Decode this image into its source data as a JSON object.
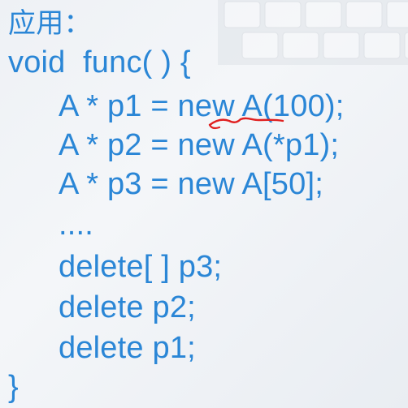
{
  "slide": {
    "heading": "应用：",
    "code_lines": [
      "void  func( ) {",
      "A * p1 = new A(100);",
      "A * p2 = new A(*p1);",
      "A * p3 = new A[50];",
      "....",
      "delete[ ] p3;",
      "delete p2;",
      "delete p1;",
      "}"
    ],
    "text_color": "#2a86d6",
    "annotation_color": "#e02020"
  }
}
